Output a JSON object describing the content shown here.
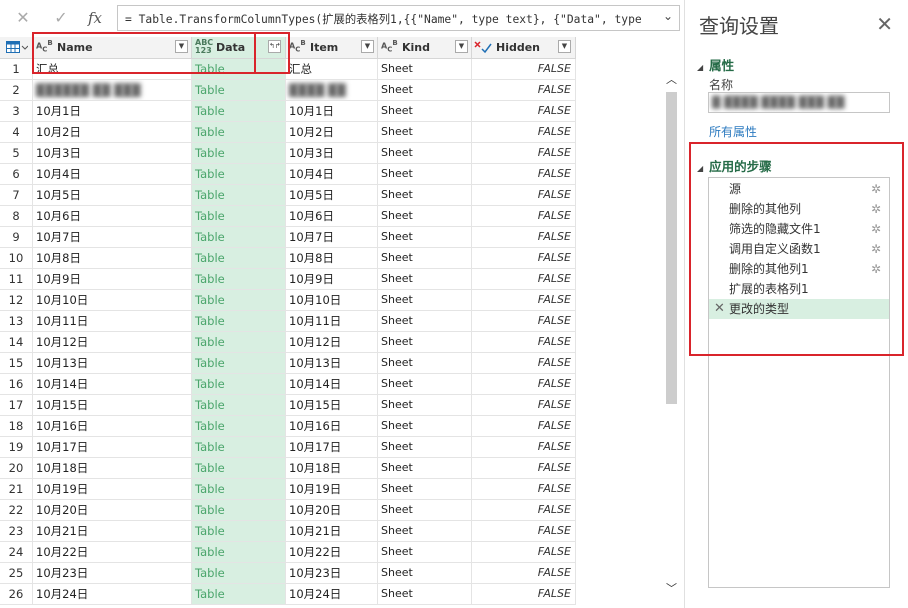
{
  "formula_bar": {
    "cancel_icon": "✕",
    "commit_icon": "✓",
    "fx_label": "fx",
    "formula": "= Table.TransformColumnTypes(扩展的表格列1,{{\"Name\", type text}, {\"Data\", type",
    "expand_icon": "⌄"
  },
  "grid": {
    "columns": [
      {
        "key": "name",
        "label": "Name",
        "type_icon": "ABC"
      },
      {
        "key": "data",
        "label": "Data",
        "type_icon": "ABC123"
      },
      {
        "key": "item",
        "label": "Item",
        "type_icon": "ABC"
      },
      {
        "key": "kind",
        "label": "Kind",
        "type_icon": "ABC"
      },
      {
        "key": "hidden",
        "label": "Hidden",
        "type_icon": "boolean"
      }
    ],
    "rows": [
      {
        "idx": "1",
        "name": "汇总",
        "data": "Table",
        "item": "汇总",
        "kind": "Sheet",
        "hidden": "FALSE"
      },
      {
        "idx": "2",
        "name": "██████ ██ ███",
        "data": "Table",
        "item": "████ ██",
        "kind": "Sheet",
        "hidden": "FALSE",
        "blurred": true
      },
      {
        "idx": "3",
        "name": "10月1日",
        "data": "Table",
        "item": "10月1日",
        "kind": "Sheet",
        "hidden": "FALSE"
      },
      {
        "idx": "4",
        "name": "10月2日",
        "data": "Table",
        "item": "10月2日",
        "kind": "Sheet",
        "hidden": "FALSE"
      },
      {
        "idx": "5",
        "name": "10月3日",
        "data": "Table",
        "item": "10月3日",
        "kind": "Sheet",
        "hidden": "FALSE"
      },
      {
        "idx": "6",
        "name": "10月4日",
        "data": "Table",
        "item": "10月4日",
        "kind": "Sheet",
        "hidden": "FALSE"
      },
      {
        "idx": "7",
        "name": "10月5日",
        "data": "Table",
        "item": "10月5日",
        "kind": "Sheet",
        "hidden": "FALSE"
      },
      {
        "idx": "8",
        "name": "10月6日",
        "data": "Table",
        "item": "10月6日",
        "kind": "Sheet",
        "hidden": "FALSE"
      },
      {
        "idx": "9",
        "name": "10月7日",
        "data": "Table",
        "item": "10月7日",
        "kind": "Sheet",
        "hidden": "FALSE"
      },
      {
        "idx": "10",
        "name": "10月8日",
        "data": "Table",
        "item": "10月8日",
        "kind": "Sheet",
        "hidden": "FALSE"
      },
      {
        "idx": "11",
        "name": "10月9日",
        "data": "Table",
        "item": "10月9日",
        "kind": "Sheet",
        "hidden": "FALSE"
      },
      {
        "idx": "12",
        "name": "10月10日",
        "data": "Table",
        "item": "10月10日",
        "kind": "Sheet",
        "hidden": "FALSE"
      },
      {
        "idx": "13",
        "name": "10月11日",
        "data": "Table",
        "item": "10月11日",
        "kind": "Sheet",
        "hidden": "FALSE"
      },
      {
        "idx": "14",
        "name": "10月12日",
        "data": "Table",
        "item": "10月12日",
        "kind": "Sheet",
        "hidden": "FALSE"
      },
      {
        "idx": "15",
        "name": "10月13日",
        "data": "Table",
        "item": "10月13日",
        "kind": "Sheet",
        "hidden": "FALSE"
      },
      {
        "idx": "16",
        "name": "10月14日",
        "data": "Table",
        "item": "10月14日",
        "kind": "Sheet",
        "hidden": "FALSE"
      },
      {
        "idx": "17",
        "name": "10月15日",
        "data": "Table",
        "item": "10月15日",
        "kind": "Sheet",
        "hidden": "FALSE"
      },
      {
        "idx": "18",
        "name": "10月16日",
        "data": "Table",
        "item": "10月16日",
        "kind": "Sheet",
        "hidden": "FALSE"
      },
      {
        "idx": "19",
        "name": "10月17日",
        "data": "Table",
        "item": "10月17日",
        "kind": "Sheet",
        "hidden": "FALSE"
      },
      {
        "idx": "20",
        "name": "10月18日",
        "data": "Table",
        "item": "10月18日",
        "kind": "Sheet",
        "hidden": "FALSE"
      },
      {
        "idx": "21",
        "name": "10月19日",
        "data": "Table",
        "item": "10月19日",
        "kind": "Sheet",
        "hidden": "FALSE"
      },
      {
        "idx": "22",
        "name": "10月20日",
        "data": "Table",
        "item": "10月20日",
        "kind": "Sheet",
        "hidden": "FALSE"
      },
      {
        "idx": "23",
        "name": "10月21日",
        "data": "Table",
        "item": "10月21日",
        "kind": "Sheet",
        "hidden": "FALSE"
      },
      {
        "idx": "24",
        "name": "10月22日",
        "data": "Table",
        "item": "10月22日",
        "kind": "Sheet",
        "hidden": "FALSE"
      },
      {
        "idx": "25",
        "name": "10月23日",
        "data": "Table",
        "item": "10月23日",
        "kind": "Sheet",
        "hidden": "FALSE"
      },
      {
        "idx": "26",
        "name": "10月24日",
        "data": "Table",
        "item": "10月24日",
        "kind": "Sheet",
        "hidden": "FALSE"
      }
    ]
  },
  "panel": {
    "title": "查询设置",
    "close_icon": "✕",
    "properties_heading": "属性",
    "name_label": "名称",
    "name_value": "█ ████ ████ ███ ██",
    "all_properties_link": "所有属性",
    "steps_heading": "应用的步骤",
    "steps": [
      {
        "label": "源",
        "gear": true
      },
      {
        "label": "删除的其他列",
        "gear": true
      },
      {
        "label": "筛选的隐藏文件1",
        "gear": true
      },
      {
        "label": "调用自定义函数1",
        "gear": true
      },
      {
        "label": "删除的其他列1",
        "gear": true
      },
      {
        "label": "扩展的表格列1",
        "gear": false
      },
      {
        "label": "更改的类型",
        "gear": false,
        "active": true
      }
    ]
  },
  "colors": {
    "highlight_green": "#d8efe1",
    "data_text": "#4aa56b",
    "section_heading": "#256b47",
    "link": "#2d7bc0",
    "annotation_red": "#d9242b"
  }
}
